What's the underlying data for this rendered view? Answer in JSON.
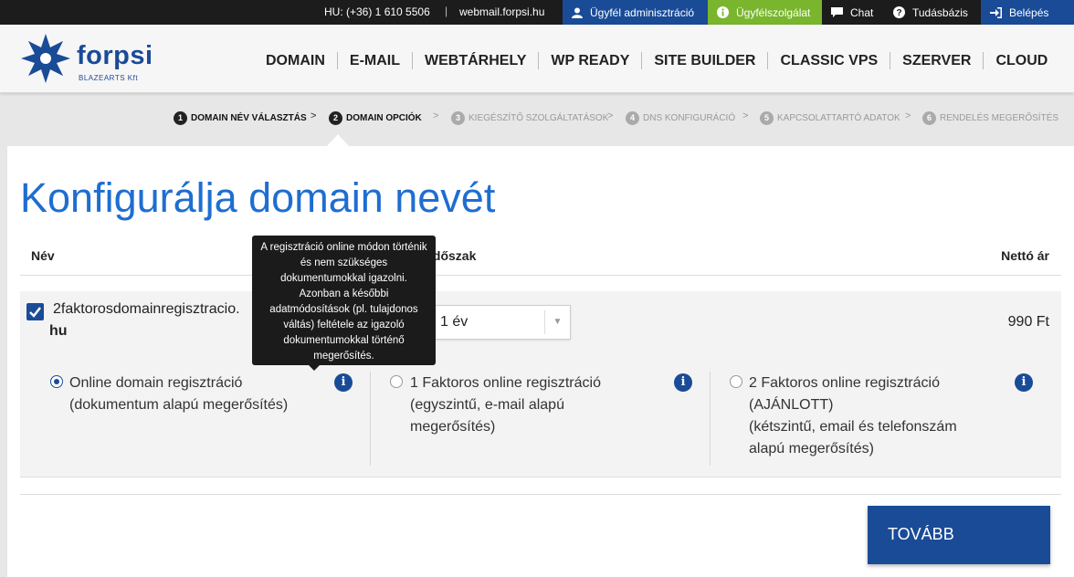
{
  "topbar": {
    "phone": "HU: (+36) 1 610 5506",
    "separator": "|",
    "webmail": "webmail.forpsi.hu",
    "admin": "Ügyfél adminisztráció",
    "support": "Ügyfélszolgálat",
    "chat": "Chat",
    "kb": "Tudásbázis",
    "login": "Belépés"
  },
  "logo": {
    "name": "forpsi",
    "sub": "BLAZEARTS Kft"
  },
  "nav": [
    "DOMAIN",
    "E-MAIL",
    "WEBTÁRHELY",
    "WP READY",
    "SITE BUILDER",
    "CLASSIC VPS",
    "SZERVER",
    "CLOUD"
  ],
  "steps": [
    {
      "num": "1",
      "label": "DOMAIN NÉV VÁLASZTÁS"
    },
    {
      "num": "2",
      "label": "DOMAIN OPCIÓK"
    },
    {
      "num": "3",
      "label": "KIEGÉSZÍTŐ SZOLGÁLTATÁSOK"
    },
    {
      "num": "4",
      "label": "DNS KONFIGURÁCIÓ"
    },
    {
      "num": "5",
      "label": "KAPCSOLATTARTÓ ADATOK"
    },
    {
      "num": "6",
      "label": "RENDELÉS MEGERŐSÍTÉS"
    }
  ],
  "step_arrow": ">",
  "title": "Konfigurálja domain nevét",
  "table": {
    "col_name": "Név",
    "col_period": "Időszak",
    "col_price": "Nettó ár"
  },
  "domain": {
    "name": "2faktorosdomainregisztracio.",
    "tld": "hu",
    "checked": true,
    "period": "1 év",
    "caret": "▼",
    "price": "990 Ft"
  },
  "options": [
    {
      "line1": "Online domain regisztráció",
      "line2": "(dokumentum alapú megerősítés)",
      "line3": "",
      "line4": "",
      "selected": true
    },
    {
      "line1": "1 Faktoros online regisztráció",
      "line2": "(egyszintű, e-mail alapú",
      "line3": "megerősítés)",
      "line4": "",
      "selected": false
    },
    {
      "line1": "2 Faktoros online regisztráció",
      "line2": "(AJÁNLOTT)",
      "line3": "(kétszintű, email és telefonszám",
      "line4": "alapú megerősítés)",
      "selected": false
    }
  ],
  "info_glyph": "i",
  "tooltip": "A regisztráció online módon történik és nem szükséges dokumentumokkal igazolni. Azonban a későbbi adatmódosítások (pl. tulajdonos váltás) feltétele az igazoló dokumentumokkal történő megerősítés.",
  "button": "TOVÁBB",
  "colors": {
    "brand_blue": "#1a4b97",
    "title_blue": "#1e6ed1",
    "support_green": "#79b52d"
  }
}
